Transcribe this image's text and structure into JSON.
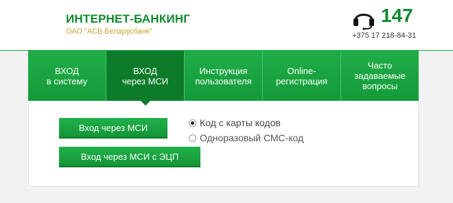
{
  "header": {
    "title": "ИНТЕРНЕТ-БАНКИНГ",
    "subtitle": "ОАО \"АСБ Беларусбанк\"",
    "phone_short": "147",
    "phone_full": "+375 17 218-84-31"
  },
  "tabs": [
    {
      "line1": "ВХОД",
      "line2": "в систему",
      "active": false
    },
    {
      "line1": "ВХОД",
      "line2": "через МСИ",
      "active": true
    },
    {
      "line1": "Инструкция",
      "line2": "пользователя",
      "active": false
    },
    {
      "line1": "Online-",
      "line2": "регистрация",
      "active": false
    },
    {
      "line1": "Часто",
      "line2": "задаваемые",
      "line3": "вопросы",
      "active": false
    }
  ],
  "buttons": {
    "msi_login": "Вход через МСИ",
    "msi_ecp_login": "Вход через МСИ с ЭЦП"
  },
  "auth_options": [
    {
      "label": "Код с карты кодов",
      "checked": true
    },
    {
      "label": "Одноразовый СМС-код",
      "checked": false
    }
  ],
  "colors": {
    "brand_green": "#0f8a2e",
    "tab_green": "#1aa541",
    "tab_active": "#0d7c2a",
    "subtitle_gold": "#c9a227"
  }
}
